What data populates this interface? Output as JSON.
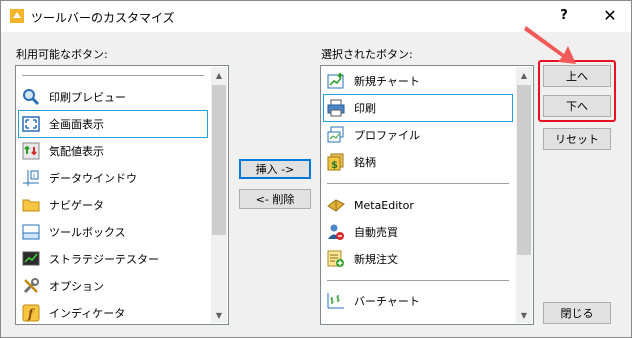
{
  "window": {
    "title": "ツールバーのカスタマイズ",
    "help_label": "?",
    "close_label": "✕"
  },
  "available": {
    "label": "利用可能なボタン:",
    "items": [
      {
        "label": "印刷プレビュー",
        "icon": "print-preview-icon"
      },
      {
        "label": "全画面表示",
        "icon": "fullscreen-icon"
      },
      {
        "label": "気配値表示",
        "icon": "market-watch-icon"
      },
      {
        "label": "データウインドウ",
        "icon": "data-window-icon"
      },
      {
        "label": "ナビゲータ",
        "icon": "navigator-icon"
      },
      {
        "label": "ツールボックス",
        "icon": "toolbox-icon"
      },
      {
        "label": "ストラテジーテスター",
        "icon": "strategy-tester-icon"
      },
      {
        "label": "オプション",
        "icon": "options-icon"
      },
      {
        "label": "インディケータ",
        "icon": "indicator-icon"
      }
    ]
  },
  "selected": {
    "label": "選択されたボタン:",
    "items": [
      {
        "label": "新規チャート",
        "icon": "new-chart-icon"
      },
      {
        "label": "印刷",
        "icon": "print-icon"
      },
      {
        "label": "プロファイル",
        "icon": "profile-icon"
      },
      {
        "label": "銘柄",
        "icon": "symbols-icon"
      },
      {
        "label": "MetaEditor",
        "icon": "metaeditor-icon"
      },
      {
        "label": "自動売買",
        "icon": "auto-trading-icon"
      },
      {
        "label": "新規注文",
        "icon": "new-order-icon"
      },
      {
        "label": "バーチャート",
        "icon": "bar-chart-icon"
      }
    ]
  },
  "buttons": {
    "insert": "挿入 ->",
    "delete": "<- 削除",
    "up": "上へ",
    "down": "下へ",
    "reset": "リセット",
    "close": "閉じる"
  },
  "colors": {
    "highlight": "#e81123",
    "arrow": "#f25a5a",
    "selection": "#26a0da"
  }
}
